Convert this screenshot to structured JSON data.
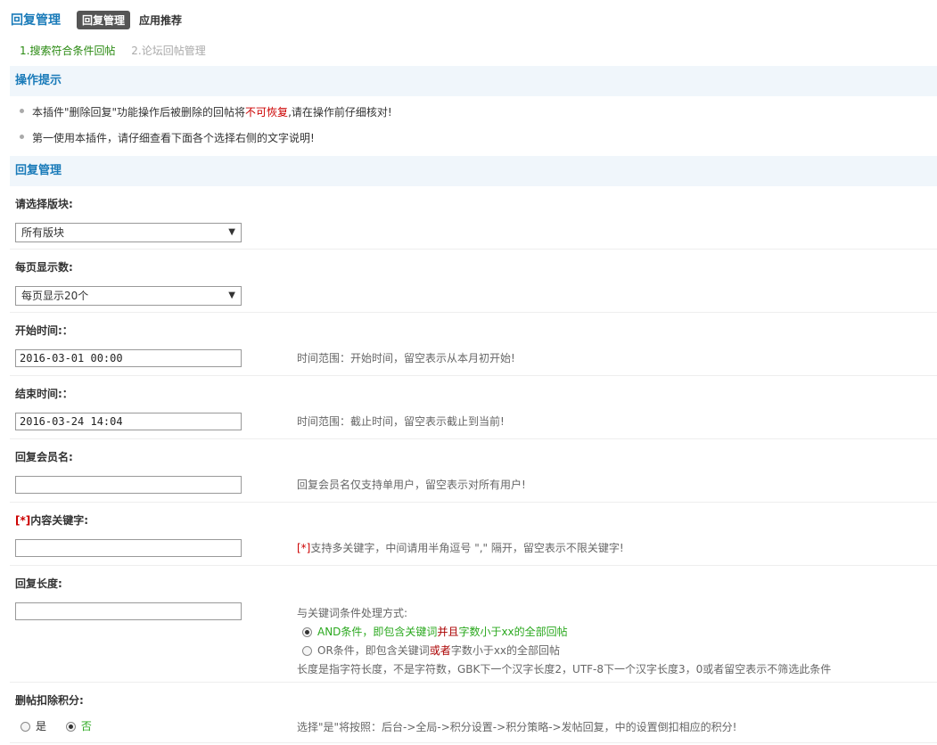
{
  "header": {
    "title": "回复管理",
    "tabs": [
      {
        "label": "回复管理"
      },
      {
        "label": "应用推荐"
      }
    ]
  },
  "steps": [
    {
      "label": "1.搜索符合条件回帖"
    },
    {
      "label": "2.论坛回帖管理"
    }
  ],
  "tips_section": {
    "title": "操作提示",
    "tip1": {
      "pre": "本插件\"删除回复\"功能操作后被删除的回帖将",
      "warn": "不可恢复",
      "post": ",请在操作前仔细核对!"
    },
    "tip2": "第一使用本插件，请仔细查看下面各个选择右侧的文字说明!"
  },
  "form_section": {
    "title": "回复管理",
    "forum": {
      "label": "请选择版块:",
      "selected": "所有版块"
    },
    "per_page": {
      "label": "每页显示数:",
      "selected": "每页显示20个"
    },
    "start_time": {
      "label": "开始时间:：",
      "value": "2016-03-01 00:00",
      "hint": "时间范围：开始时间，留空表示从本月初开始!"
    },
    "end_time": {
      "label": "结束时间:：",
      "value": "2016-03-24 14:04",
      "hint": "时间范围：截止时间，留空表示截止到当前!"
    },
    "member": {
      "label": "回复会员名:",
      "value": "",
      "hint": "回复会员名仅支持单用户，留空表示对所有用户!"
    },
    "keywords": {
      "req": "[*]",
      "label": "内容关键字:",
      "value": "",
      "hint_req": "[*]",
      "hint": "支持多关键字，中间请用半角逗号 \",\" 隔开，留空表示不限关键字!"
    },
    "length": {
      "label": "回复长度:",
      "value": "",
      "mode_title": "与关键词条件处理方式:",
      "and": {
        "a": "AND条件，即包含关键词",
        "b": "并且",
        "c": "字数小于xx的全部回帖"
      },
      "or": {
        "a": "OR条件，即包含关键词",
        "b": "或者",
        "c": "字数小于xx的全部回帖"
      },
      "note": "长度是指字符长度，不是字符数，GBK下一个汉字长度2，UTF-8下一个汉字长度3，0或者留空表示不筛选此条件"
    },
    "deduct": {
      "label": "删帖扣除积分:",
      "yes": "是",
      "no": "否",
      "selected": "否",
      "hint": "选择\"是\"将按照：后台->全局->积分设置->积分策略->发帖回复，中的设置倒扣相应的积分!"
    }
  }
}
